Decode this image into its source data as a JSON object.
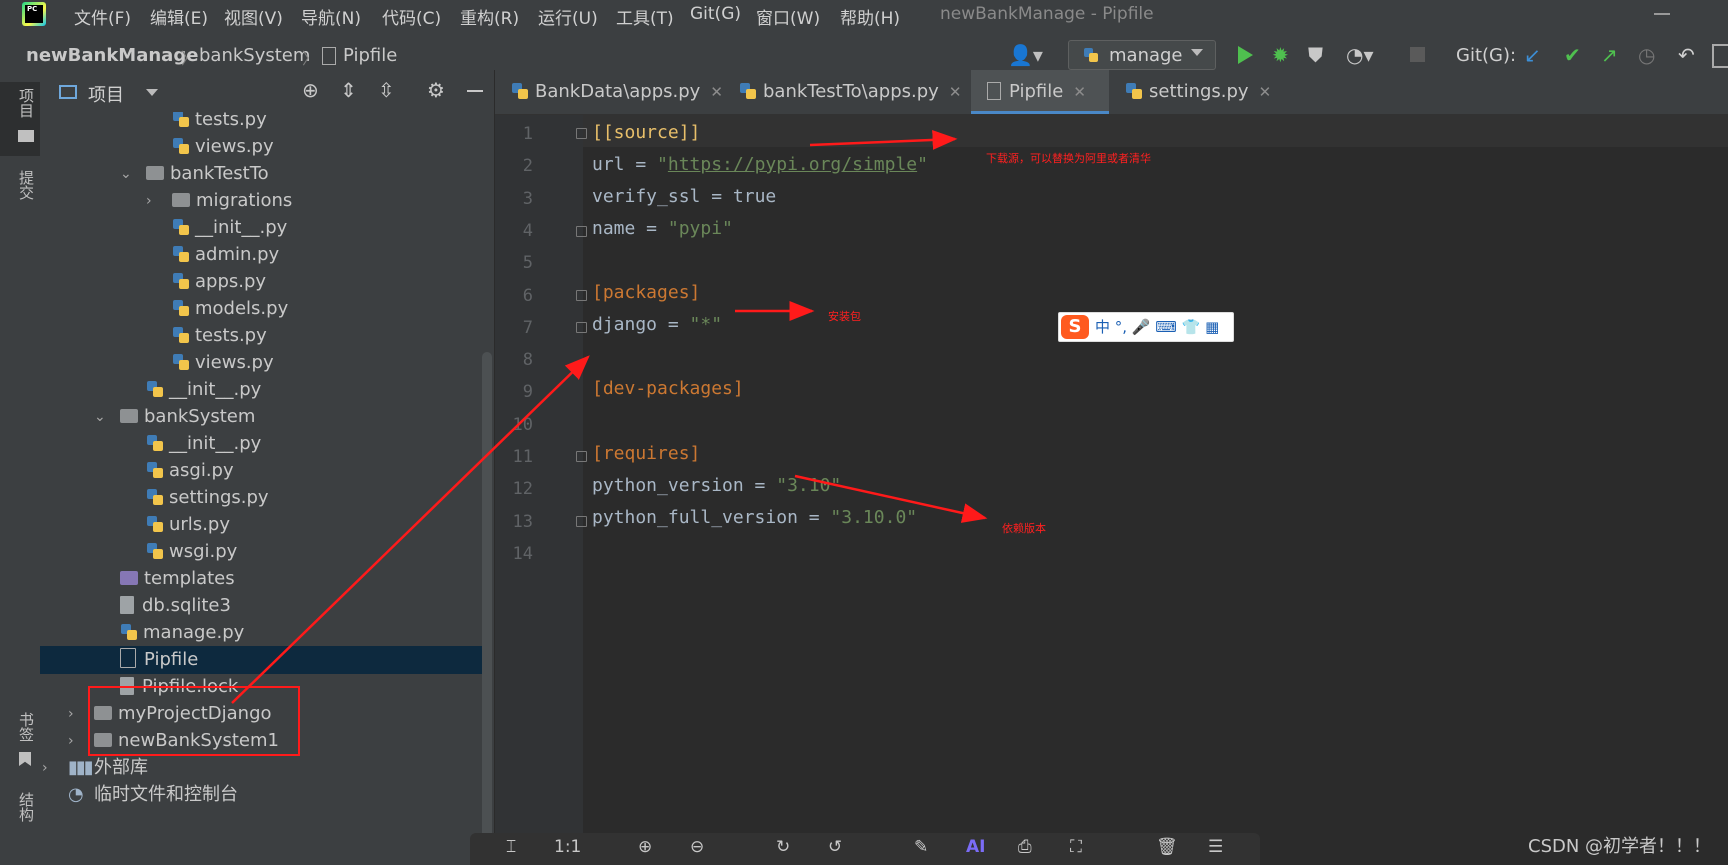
{
  "menubar": {
    "items": [
      "文件(F)",
      "编辑(E)",
      "视图(V)",
      "导航(N)",
      "代码(C)",
      "重构(R)",
      "运行(U)",
      "工具(T)",
      "Git(G)",
      "窗口(W)",
      "帮助(H)"
    ],
    "window_title": "newBankManage - Pipfile"
  },
  "breadcrumb": [
    "newBankManage",
    "bankSystem",
    "Pipfile"
  ],
  "toolbar": {
    "run_config": "manage",
    "git_label": "Git(G):"
  },
  "leftstrip": {
    "project": "项目",
    "commit": "提交",
    "bookmarks": "书签",
    "structure": "结构"
  },
  "project_panel": {
    "title": "项目",
    "tree": [
      {
        "label": "tests.py",
        "kind": "py",
        "depth": 3
      },
      {
        "label": "views.py",
        "kind": "py",
        "depth": 3
      },
      {
        "label": "bankTestTo",
        "kind": "pkg",
        "depth": 2,
        "expanded": true
      },
      {
        "label": "migrations",
        "kind": "folder",
        "depth": 3,
        "expanded": false
      },
      {
        "label": "__init__.py",
        "kind": "py",
        "depth": 3
      },
      {
        "label": "admin.py",
        "kind": "py",
        "depth": 3
      },
      {
        "label": "apps.py",
        "kind": "py",
        "depth": 3
      },
      {
        "label": "models.py",
        "kind": "py",
        "depth": 3
      },
      {
        "label": "tests.py",
        "kind": "py",
        "depth": 3
      },
      {
        "label": "views.py",
        "kind": "py",
        "depth": 3
      },
      {
        "label": "__init__.py",
        "kind": "py",
        "depth": 2
      },
      {
        "label": "bankSystem",
        "kind": "pkg",
        "depth": 1,
        "expanded": true
      },
      {
        "label": "__init__.py",
        "kind": "py",
        "depth": 2
      },
      {
        "label": "asgi.py",
        "kind": "py",
        "depth": 2
      },
      {
        "label": "settings.py",
        "kind": "py",
        "depth": 2
      },
      {
        "label": "urls.py",
        "kind": "py",
        "depth": 2
      },
      {
        "label": "wsgi.py",
        "kind": "py",
        "depth": 2
      },
      {
        "label": "templates",
        "kind": "templates",
        "depth": 1
      },
      {
        "label": "db.sqlite3",
        "kind": "file",
        "depth": 1
      },
      {
        "label": "manage.py",
        "kind": "py",
        "depth": 1
      },
      {
        "label": "Pipfile",
        "kind": "pipfile",
        "depth": 1,
        "selected": true
      },
      {
        "label": "Pipfile.lock",
        "kind": "file",
        "depth": 1
      },
      {
        "label": "myProjectDjango",
        "kind": "folder",
        "depth": 0,
        "expanded": false
      },
      {
        "label": "newBankSystem1",
        "kind": "folder",
        "depth": 0,
        "expanded": false
      },
      {
        "label": "外部库",
        "kind": "lib",
        "depth": -1,
        "expanded": false
      },
      {
        "label": "临时文件和控制台",
        "kind": "scratch",
        "depth": -1
      }
    ]
  },
  "tabs": [
    {
      "label": "BankData\\apps.py",
      "active": false
    },
    {
      "label": "bankTestTo\\apps.py",
      "active": false
    },
    {
      "label": "Pipfile",
      "active": true
    },
    {
      "label": "settings.py",
      "active": false
    }
  ],
  "editor": {
    "line_numbers": [
      "1",
      "2",
      "3",
      "4",
      "5",
      "6",
      "7",
      "8",
      "9",
      "10",
      "11",
      "12",
      "13",
      "14"
    ],
    "lines": {
      "l1": "[[source]]",
      "l2_key": "url = ",
      "l2_q1": "\"",
      "l2_url": "https://pypi.org/simple",
      "l2_q2": "\"",
      "l3_key": "verify_ssl = ",
      "l3_val": "true",
      "l4_key": "name = ",
      "l4_val": "\"pypi\"",
      "l6": "[packages]",
      "l7_key": "django = ",
      "l7_val": "\"*\"",
      "l9": "[dev-packages]",
      "l11": "[requires]",
      "l12_key": "python_version = ",
      "l12_val": "\"3.10\"",
      "l13_key": "python_full_version = ",
      "l13_val": "\"3.10.0\""
    }
  },
  "annotations": {
    "source": "下载源，可以替换为阿里或者清华",
    "packages": "安装包",
    "requires": "依赖版本"
  },
  "ime": {
    "brand": "S",
    "text": "中 °, 🎤 ⌨ 👕 ▦"
  },
  "bottom_toolbar": {
    "zoom": "1:1"
  },
  "watermark": "CSDN @初学者！！！",
  "colors": {
    "accent": "#4a88c7",
    "annotation": "#ff1a1a",
    "selection": "#0d293e"
  }
}
